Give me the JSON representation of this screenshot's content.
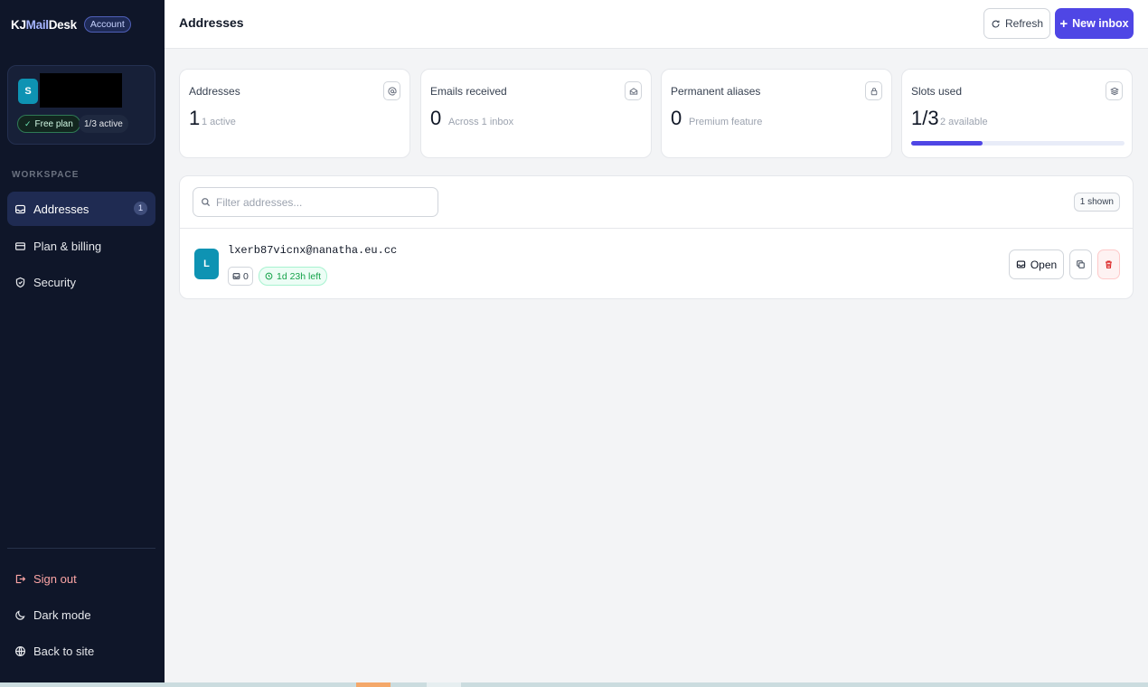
{
  "brand": {
    "name_part1": "KJ",
    "name_part2": "Mail",
    "name_part3": "Desk",
    "account_label": "Account"
  },
  "user": {
    "avatar_letter": "S",
    "plan": "Free plan",
    "active": "1/3 active"
  },
  "sidebar": {
    "section_label": "WORKSPACE",
    "items": [
      {
        "label": "Addresses",
        "badge": "1",
        "icon": "inbox-icon"
      },
      {
        "label": "Plan & billing",
        "icon": "credit-card-icon"
      },
      {
        "label": "Security",
        "icon": "shield-icon"
      }
    ],
    "footer_items": [
      {
        "label": "Sign out",
        "icon": "logout-icon"
      },
      {
        "label": "Dark mode",
        "icon": "moon-icon"
      },
      {
        "label": "Back to site",
        "icon": "globe-icon"
      }
    ]
  },
  "header": {
    "title": "Addresses",
    "refresh_label": "Refresh",
    "new_inbox_label": "New inbox"
  },
  "stats": [
    {
      "label": "Addresses",
      "value": "1",
      "sub": "1 active",
      "icon": "at-icon"
    },
    {
      "label": "Emails received",
      "value": "0",
      "sub": "Across 1 inbox",
      "icon": "mail-open-icon"
    },
    {
      "label": "Permanent aliases",
      "value": "0",
      "sub": "Premium feature",
      "icon": "lock-icon"
    },
    {
      "label": "Slots used",
      "value": "1/3",
      "sub": "2 available",
      "icon": "layers-icon",
      "progress": 0.333
    }
  ],
  "list": {
    "filter_placeholder": "Filter addresses...",
    "shown_label": "1 shown",
    "rows": [
      {
        "avatar_letter": "L",
        "email": "lxerb87vicnx@nanatha.eu.cc",
        "mail_count": "0",
        "time_left": "1d 23h left",
        "open_label": "Open"
      }
    ]
  },
  "colors": {
    "accent": "#4f46e5",
    "sidebar_bg": "#0f1629",
    "avatar": "#0e93b3",
    "success": "#16a34a",
    "danger": "#dc2626"
  }
}
